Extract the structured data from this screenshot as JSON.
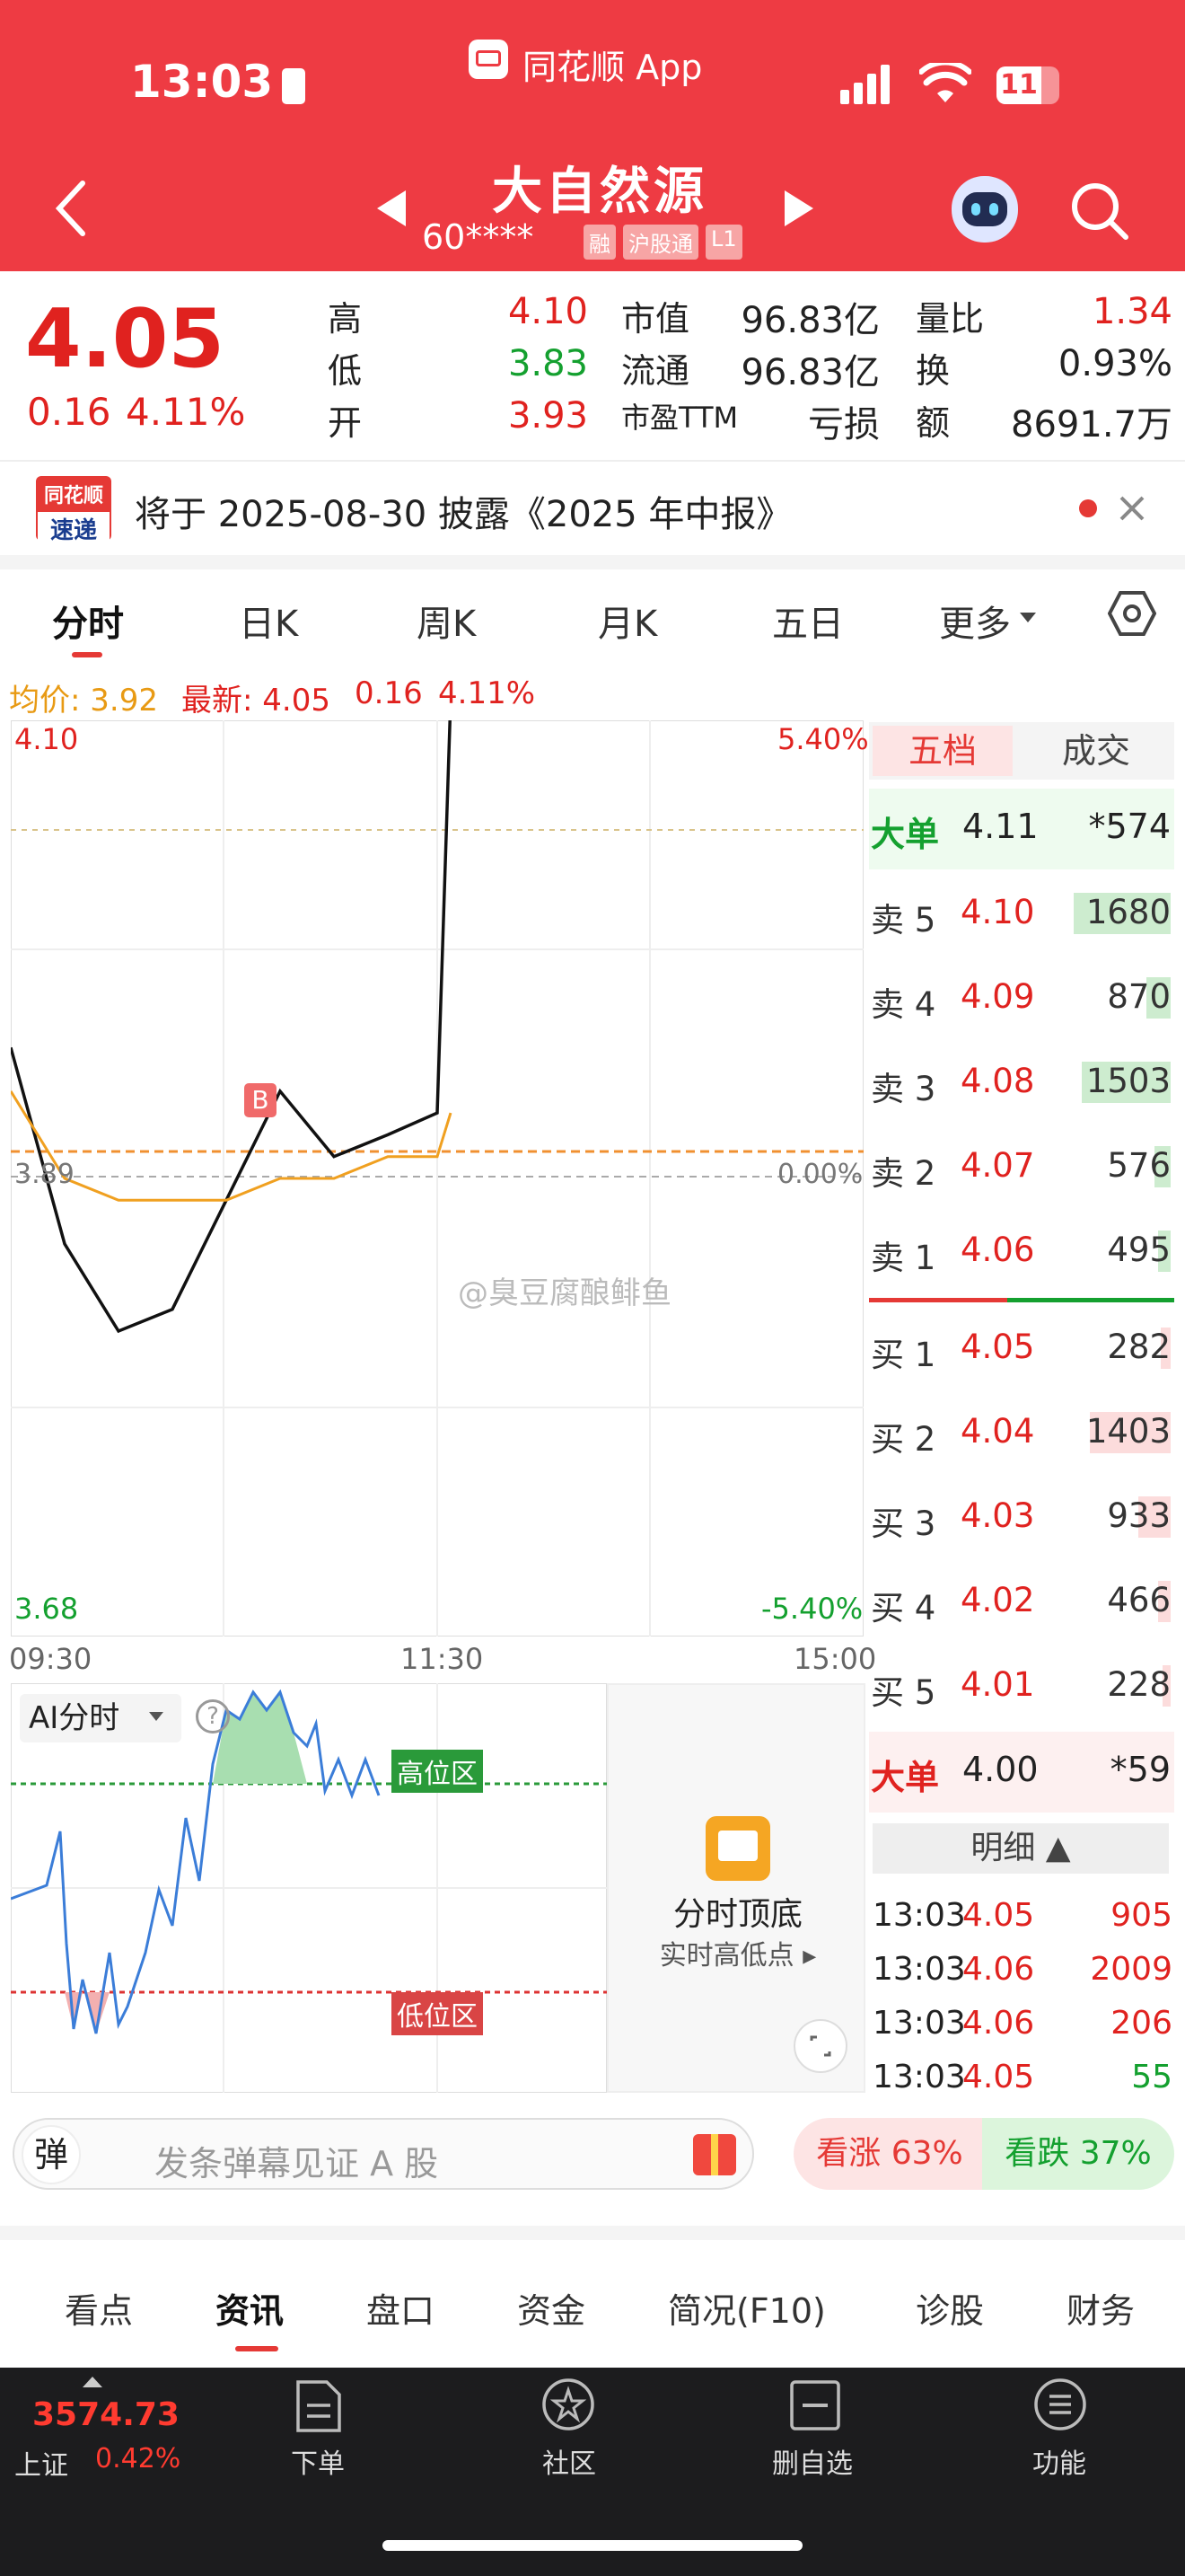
{
  "status": {
    "time": "13:03",
    "app_label": "同花顺 App",
    "battery": "11"
  },
  "header": {
    "stock_name": "大自然源",
    "stock_code": "60****",
    "badges": [
      "融",
      "沪股通",
      "L1"
    ]
  },
  "quote": {
    "price": "4.05",
    "change": "0.16",
    "change_pct": "4.11%",
    "stats": [
      {
        "label": "高",
        "value": "4.10",
        "color": "red"
      },
      {
        "label": "低",
        "value": "3.83",
        "color": "green"
      },
      {
        "label": "开",
        "value": "3.93",
        "color": "red"
      }
    ],
    "stats2": [
      {
        "label": "市值",
        "value": "96.83亿"
      },
      {
        "label": "流通",
        "value": "96.83亿"
      },
      {
        "label": "市盈TTM",
        "value": "亏损"
      }
    ],
    "stats3": [
      {
        "label": "量比",
        "value": "1.34",
        "color": "red"
      },
      {
        "label": "换",
        "value": "0.93%"
      },
      {
        "label": "额",
        "value": "8691.7万"
      }
    ]
  },
  "notice": {
    "logo_top": "同花顺",
    "logo_bottom": "速递",
    "text": "将于 2025-08-30 披露《2025 年中报》"
  },
  "chart_tabs": [
    "分时",
    "日K",
    "周K",
    "月K",
    "五日",
    "更多"
  ],
  "info_line": {
    "avg_label": "均价: 3.92",
    "latest_label": "最新: 4.05",
    "chg": "0.16",
    "pct": "4.11%"
  },
  "axis": {
    "top_price": "4.10",
    "top_pct": "5.40%",
    "mid_price": "3.89",
    "mid_pct": "0.00%",
    "bot_price": "3.68",
    "bot_pct": "-5.40%",
    "t_start": "09:30",
    "t_mid": "11:30",
    "t_end": "15:00",
    "marker": "B"
  },
  "watermark": "@臭豆腐酿鲱鱼",
  "chart_data": {
    "type": "line",
    "y_range": [
      3.68,
      4.1
    ],
    "x": [
      "09:30",
      "09:45",
      "10:00",
      "10:15",
      "10:30",
      "10:45",
      "11:00",
      "11:15",
      "11:30",
      "11:32"
    ],
    "series": [
      {
        "name": "最新",
        "values": [
          3.95,
          3.86,
          3.82,
          3.83,
          3.88,
          3.93,
          3.9,
          3.91,
          3.92,
          4.11
        ]
      },
      {
        "name": "均价",
        "values": [
          3.93,
          3.89,
          3.88,
          3.88,
          3.88,
          3.89,
          3.89,
          3.9,
          3.9,
          3.92
        ]
      }
    ]
  },
  "orderbook": {
    "tabs": [
      "五档",
      "成交"
    ],
    "big_sell": {
      "label": "大单",
      "price": "4.11",
      "vol": "*574"
    },
    "asks": [
      {
        "label": "卖 5",
        "price": "4.10",
        "vol": "1680",
        "bar": 0.6
      },
      {
        "label": "卖 4",
        "price": "4.09",
        "vol": "870",
        "bar": 0.15
      },
      {
        "label": "卖 3",
        "price": "4.08",
        "vol": "1503",
        "bar": 0.55
      },
      {
        "label": "卖 2",
        "price": "4.07",
        "vol": "576",
        "bar": 0.1
      },
      {
        "label": "卖 1",
        "price": "4.06",
        "vol": "495",
        "bar": 0.08
      }
    ],
    "bids": [
      {
        "label": "买 1",
        "price": "4.05",
        "vol": "282",
        "bar": 0.06
      },
      {
        "label": "买 2",
        "price": "4.04",
        "vol": "1403",
        "bar": 0.5
      },
      {
        "label": "买 3",
        "price": "4.03",
        "vol": "933",
        "bar": 0.2
      },
      {
        "label": "买 4",
        "price": "4.02",
        "vol": "466",
        "bar": 0.08
      },
      {
        "label": "买 5",
        "price": "4.01",
        "vol": "228",
        "bar": 0.05
      }
    ],
    "big_buy": {
      "label": "大单",
      "price": "4.00",
      "vol": "*59"
    },
    "detail_label": "明细 ▲",
    "trades": [
      {
        "t": "13:03",
        "p": "4.05",
        "v": "905",
        "c": "red"
      },
      {
        "t": "13:03",
        "p": "4.06",
        "v": "2009",
        "c": "red"
      },
      {
        "t": "13:03",
        "p": "4.06",
        "v": "206",
        "c": "red"
      },
      {
        "t": "13:03",
        "p": "4.05",
        "v": "55",
        "c": "green"
      }
    ]
  },
  "ai": {
    "label": "AI分时",
    "high_zone": "高位区",
    "low_zone": "低位区",
    "promo_title": "分时顶底",
    "promo_sub": "实时高低点 ▸"
  },
  "danmu": {
    "icon": "弹",
    "placeholder": "发条弹幕见证 A 股",
    "up": "看涨 63%",
    "down": "看跌 37%"
  },
  "bottom_tabs": [
    "看点",
    "资讯",
    "盘口",
    "资金",
    "简况(F10)",
    "诊股",
    "财务"
  ],
  "footer": {
    "index_value": "3574.73",
    "index_name": "上证",
    "index_pct": "0.42%",
    "items": [
      "下单",
      "社区",
      "删自选",
      "功能"
    ]
  }
}
